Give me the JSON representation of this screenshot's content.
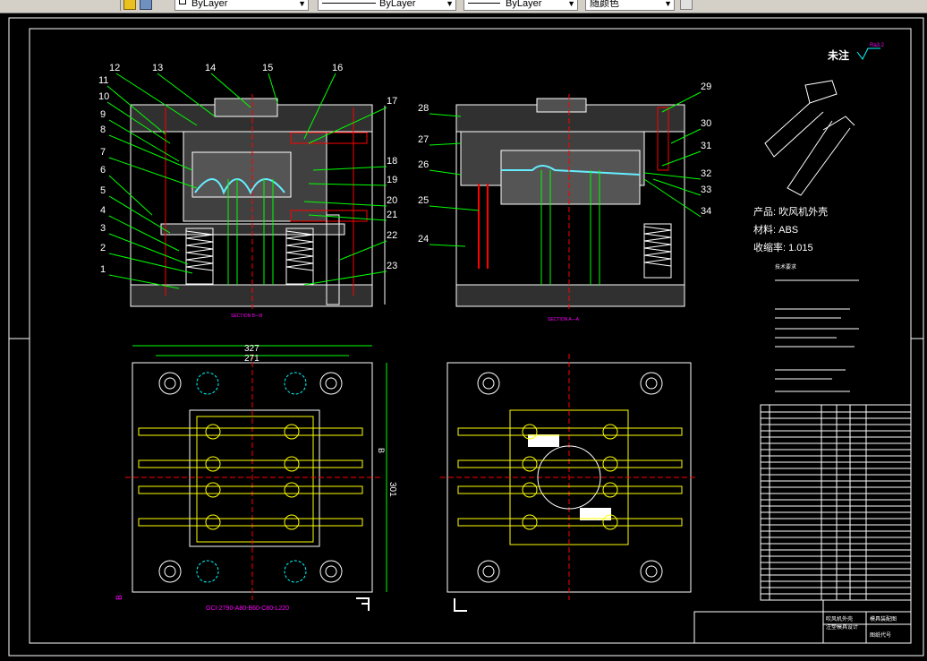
{
  "toolbar": {
    "layer_linetype": "ByLayer",
    "layer_lineweight": "ByLayer",
    "layer_plot": "ByLayer",
    "color_select": "随颜色"
  },
  "drawing": {
    "section_left": "SECTION B—B",
    "section_right": "SECTION A—A",
    "note_title": "未注",
    "roughness": "Ra3.2",
    "product_label": "产品: 吹风机外壳",
    "material_label": "材料: ABS",
    "shrink_label": "收缩率: 1.015",
    "tech_title": "技术要求",
    "dims": [
      "327",
      "271",
      "301",
      "B",
      "B"
    ],
    "mold_base": "GCI-2790-A80-B60-C80-L220",
    "left_numbers": [
      "12",
      "13",
      "14",
      "15",
      "16",
      "11",
      "10",
      "9",
      "8",
      "7",
      "6",
      "5",
      "4",
      "3",
      "2",
      "1"
    ],
    "right_numbers": [
      "17",
      "18",
      "19",
      "20",
      "21",
      "22",
      "23"
    ],
    "a_left_numbers": [
      "28",
      "27",
      "26",
      "25",
      "24"
    ],
    "a_right_numbers": [
      "29",
      "30",
      "31",
      "32",
      "33",
      "34"
    ],
    "title_block": [
      "吹风机外壳",
      "注塑模具设计",
      "模具装配图",
      "图纸代号"
    ]
  }
}
